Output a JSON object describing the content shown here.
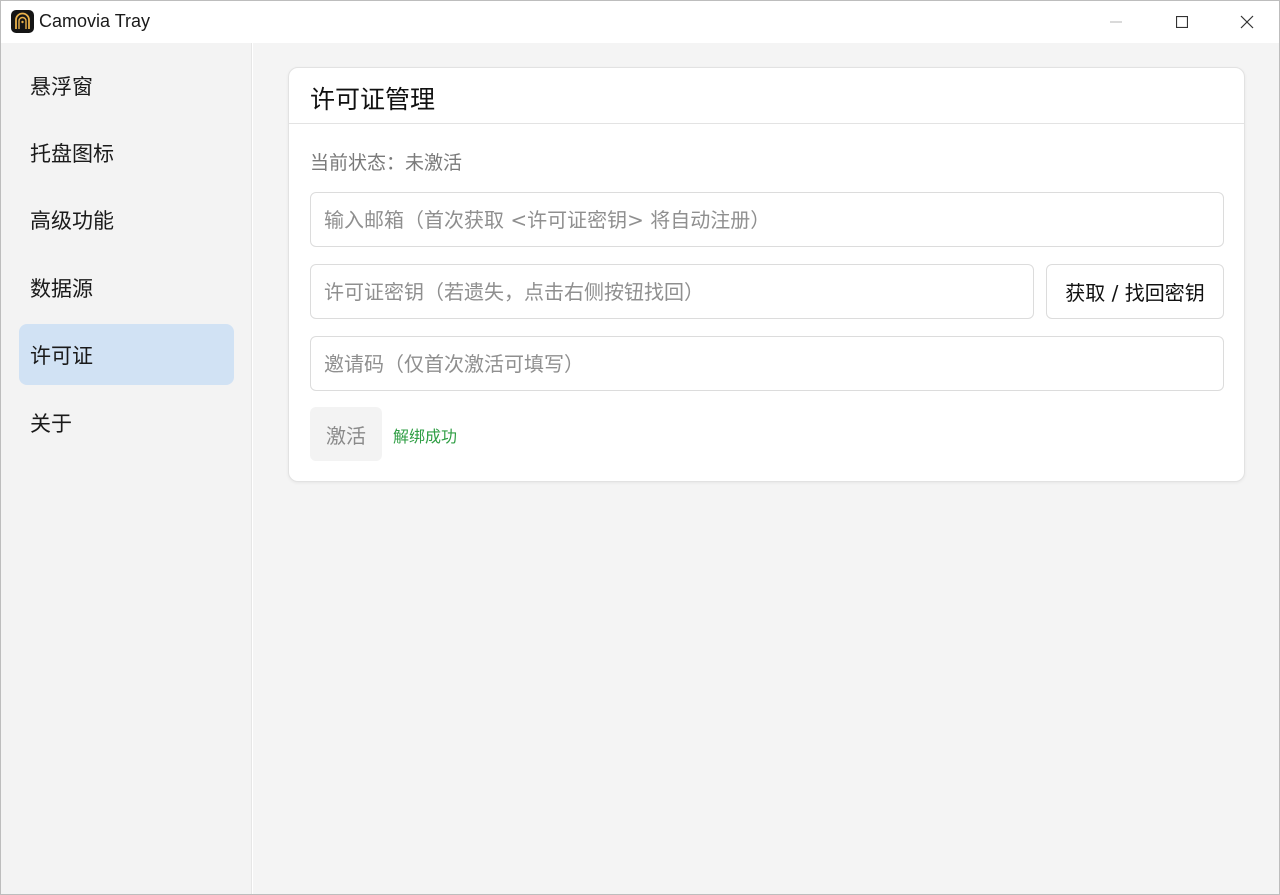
{
  "window": {
    "title": "Camovia Tray",
    "icon": "camovia-app-icon",
    "controls": [
      "minimize-icon",
      "maximize-icon",
      "close-icon"
    ]
  },
  "sidebar": {
    "items": [
      {
        "label": "悬浮窗",
        "active": false
      },
      {
        "label": "托盘图标",
        "active": false
      },
      {
        "label": "高级功能",
        "active": false
      },
      {
        "label": "数据源",
        "active": false
      },
      {
        "label": "许可证",
        "active": true
      },
      {
        "label": "关于",
        "active": false
      }
    ]
  },
  "license": {
    "title": "许可证管理",
    "status": "当前状态：未激活",
    "email": {
      "value": "",
      "placeholder": "输入邮箱（首次获取 <许可证密钥> 将自动注册）"
    },
    "key": {
      "value": "",
      "placeholder": "许可证密钥（若遗失，点击右侧按钮找回）"
    },
    "fetch_button": "获取 / 找回密钥",
    "invite": {
      "value": "",
      "placeholder": "邀请码（仅首次激活可填写）"
    },
    "activate_button": "激活",
    "message": "解绑成功"
  },
  "colors": {
    "sidebar_active": "#d1e2f4",
    "success_text": "#2f9e44",
    "main_bg": "#f4f4f4"
  }
}
